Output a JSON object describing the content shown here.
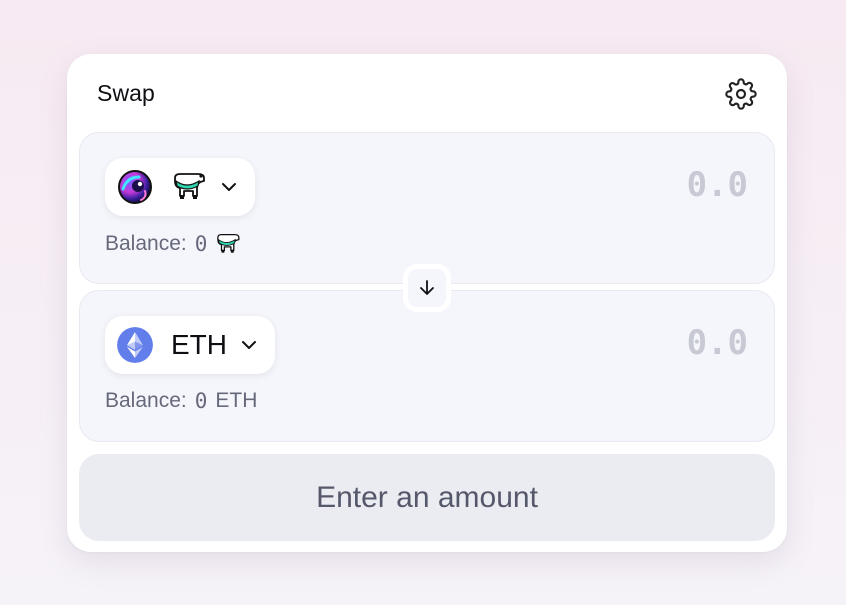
{
  "header": {
    "title": "Swap",
    "settings_icon": "gear-icon"
  },
  "input_panel": {
    "token_icon": "cow-token-icon",
    "amount_placeholder": "0.0",
    "balance_label": "Balance:",
    "balance_value": "0"
  },
  "output_panel": {
    "token_icon": "eth-icon",
    "token_symbol": "ETH",
    "amount_placeholder": "0.0",
    "balance_label": "Balance:",
    "balance_value": "0",
    "balance_symbol": "ETH"
  },
  "switch_icon": "arrow-down-icon",
  "cta_label": "Enter an amount",
  "colors": {
    "eth_blue": "#627eea",
    "cow_teal": "#32d6b8",
    "cta_bg": "#ebecf2",
    "panel_bg": "#f5f6fc"
  }
}
